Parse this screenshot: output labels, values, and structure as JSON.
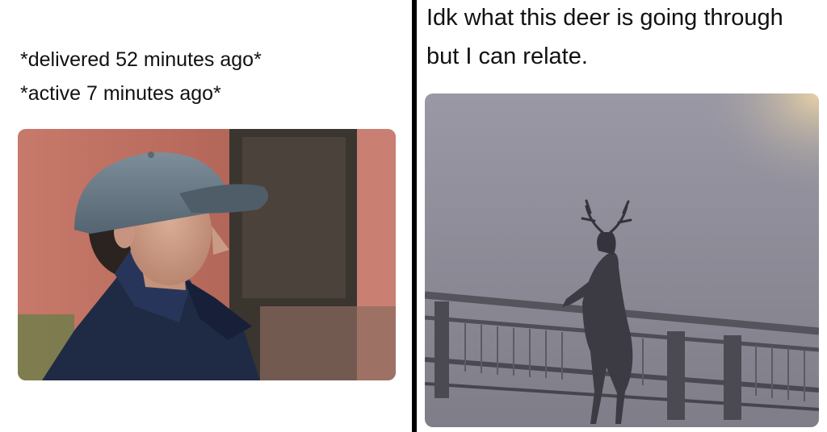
{
  "left_panel": {
    "line1": "*delivered 52 minutes ago*",
    "line2": "*active 7 minutes ago*",
    "photo_subject": "man-in-gray-cap"
  },
  "right_panel": {
    "line1": "Idk what this deer is going through",
    "line2": "but I can relate.",
    "photo_subject": "deer-on-bridge-in-fog"
  },
  "colors": {
    "divider": "#000000",
    "background": "#ffffff",
    "fog": "#8d8b97",
    "brick": "#c7796a"
  }
}
